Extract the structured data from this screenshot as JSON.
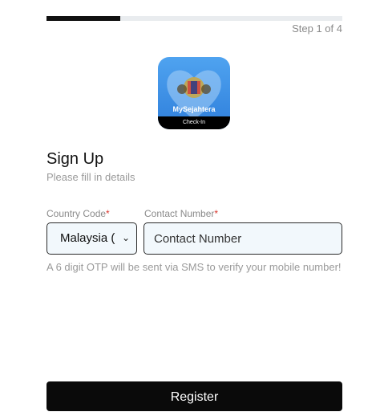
{
  "progress": {
    "fraction": 0.25,
    "step_text": "Step 1 of 4"
  },
  "logo": {
    "name": "MySejahtera",
    "strip_text": "Check-In"
  },
  "header": {
    "title": "Sign Up",
    "subtitle": "Please fill in details"
  },
  "form": {
    "country_code": {
      "label": "Country Code",
      "value": "Malaysia ("
    },
    "contact_number": {
      "label": "Contact Number",
      "placeholder": "Contact Number",
      "value": ""
    },
    "required_marker": "*",
    "help_text": "A 6 digit OTP will be sent via SMS to verify your mobile number!"
  },
  "actions": {
    "register_label": "Register"
  },
  "colors": {
    "accent": "#000000",
    "logo_blue": "#3f8fe6",
    "required": "#d9342b"
  }
}
